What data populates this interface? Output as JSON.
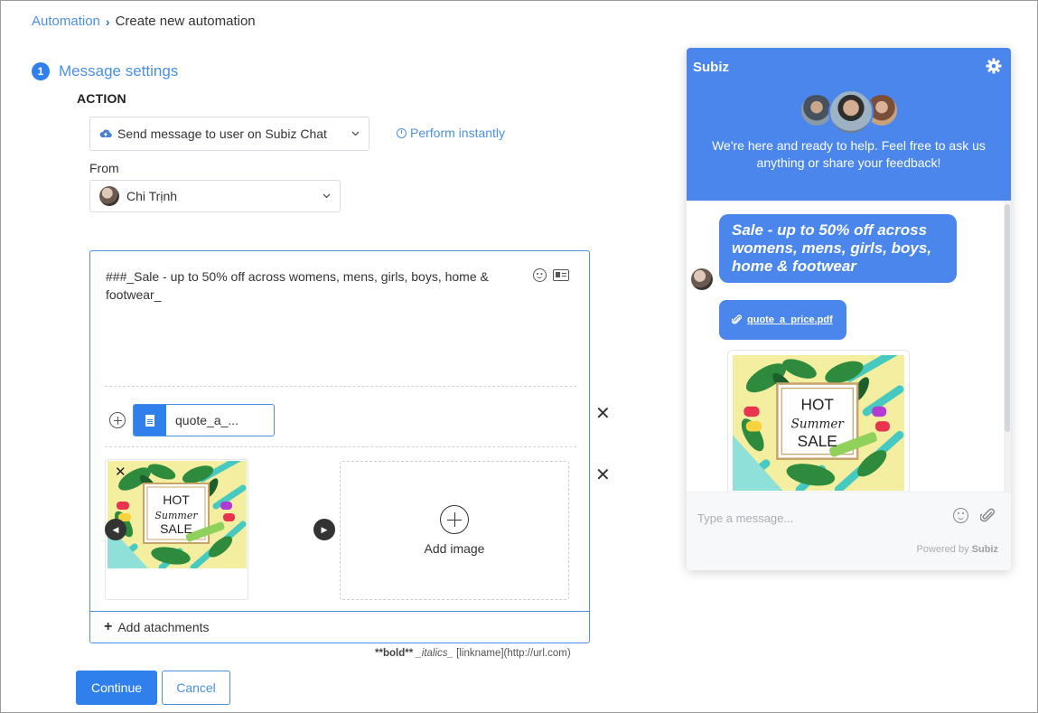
{
  "breadcrumb": {
    "parent": "Automation",
    "separator": "›",
    "current": "Create new automation"
  },
  "step": {
    "number": "1",
    "title": "Message settings"
  },
  "action": {
    "label": "ACTION",
    "selected": "Send message to user on Subiz Chat",
    "perform": "Perform instantly"
  },
  "from": {
    "label": "From",
    "selected": "Chi Trịnh"
  },
  "editor": {
    "text": "###_Sale - up to 50% off across womens, mens, girls, boys, home & footwear_",
    "file_name": "quote_a_...",
    "add_image_label": "Add image",
    "add_attachments": "Add atachments",
    "image_text": {
      "line1": "HOT",
      "line2": "Summer",
      "line3": "SALE"
    }
  },
  "markdown_hint": {
    "bold": "**bold**",
    "italics": "_italics_",
    "link": "[linkname](http://url.com)"
  },
  "buttons": {
    "continue": "Continue",
    "cancel": "Cancel"
  },
  "widget": {
    "title": "Subiz",
    "intro": "We're here and ready to help. Feel free to ask us anything or share your feedback!",
    "message": "Sale - up to 50% off across womens, mens, girls, boys, home & footwear",
    "attachment": "quote_a_price.pdf",
    "input_placeholder": "Type a message...",
    "powered_prefix": "Powered by",
    "powered_brand": "Subiz"
  },
  "colors": {
    "accent": "#2f80ed",
    "link": "#4a90e2",
    "widget_header": "#4a86ec"
  },
  "icons": [
    "cloud-upload-icon",
    "clock-icon",
    "emoji-icon",
    "contact-card-icon",
    "plus-circle-icon",
    "document-icon",
    "close-icon",
    "chevron-left-icon",
    "chevron-right-icon",
    "gear-icon",
    "paperclip-icon"
  ]
}
